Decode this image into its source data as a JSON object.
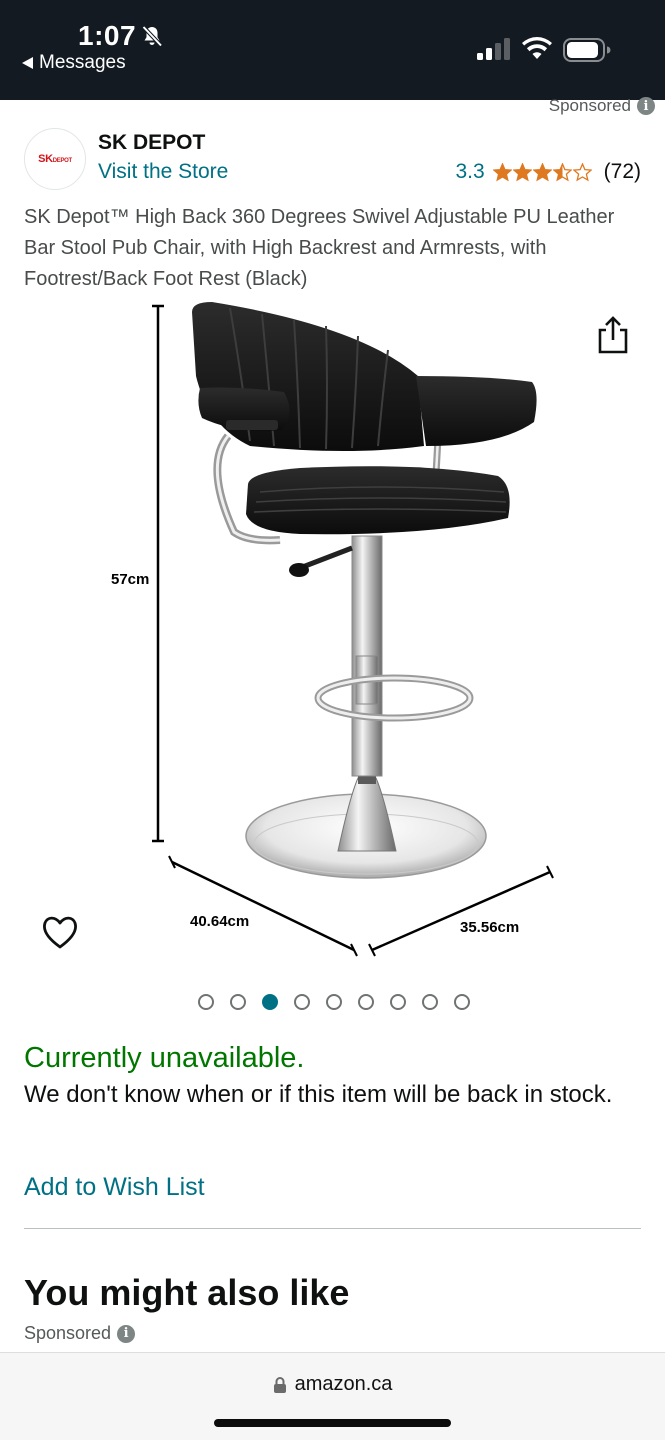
{
  "status_bar": {
    "time": "1:07",
    "back_app": "Messages"
  },
  "header": {
    "sponsored_label": "Sponsored",
    "info_glyph": "i",
    "brand_logo_text": "SK",
    "brand_logo_sub": "DEPOT",
    "brand_name": "SK DEPOT",
    "visit_store": "Visit the Store",
    "rating_value": "3.3",
    "rating_stars": 3.5,
    "rating_count": "(72)"
  },
  "product": {
    "title": "SK Depot™ High Back 360 Degrees Swivel Adjustable PU Leather Bar Stool Pub Chair, with High Backrest and Armrests, with Footrest/Back Foot Rest (Black)",
    "dimension_height": "57cm",
    "dimension_width": "40.64cm",
    "dimension_depth": "35.56cm",
    "image_count": 9,
    "active_image_index": 2
  },
  "availability": {
    "status": "Currently unavailable.",
    "message": "We don't know when or if this item will be back in stock.",
    "wishlist_link": "Add to Wish List"
  },
  "recommendations": {
    "title": "You might also like",
    "sponsored_label": "Sponsored"
  },
  "browser": {
    "address": "amazon.ca"
  },
  "colors": {
    "link": "#007185",
    "available_green": "#007600",
    "star_orange": "#de7921",
    "status_bar_bg": "#131a22"
  },
  "icons": [
    "bell-slash-icon",
    "signal-icon",
    "wifi-icon",
    "battery-icon",
    "info-icon",
    "star-icon",
    "share-icon",
    "heart-icon",
    "lock-icon"
  ]
}
